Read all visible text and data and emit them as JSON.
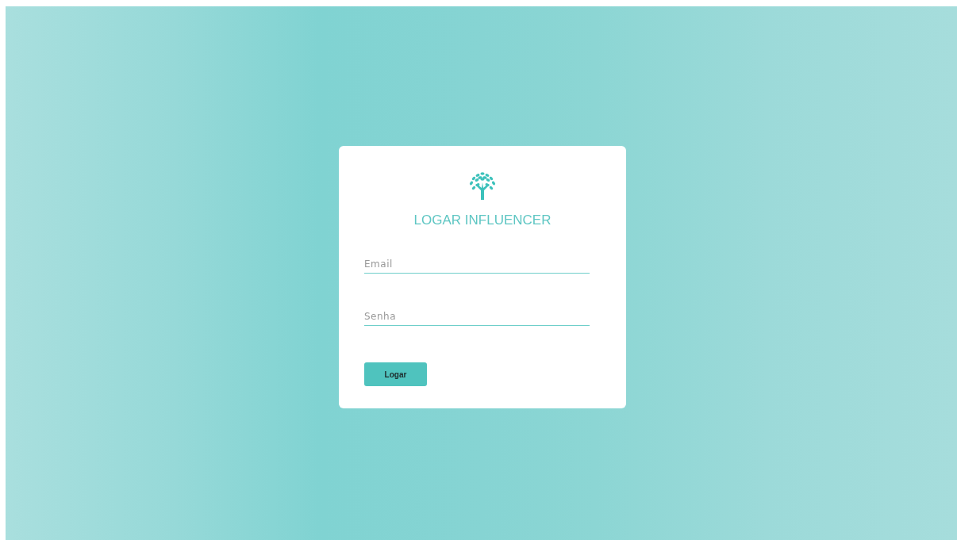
{
  "login": {
    "logo": {
      "kind": "tree"
    },
    "title": "LOGAR INFLUENCER",
    "fields": [
      {
        "placeholder": "Email"
      },
      {
        "placeholder": "Senha"
      }
    ],
    "button": "Logar"
  }
}
